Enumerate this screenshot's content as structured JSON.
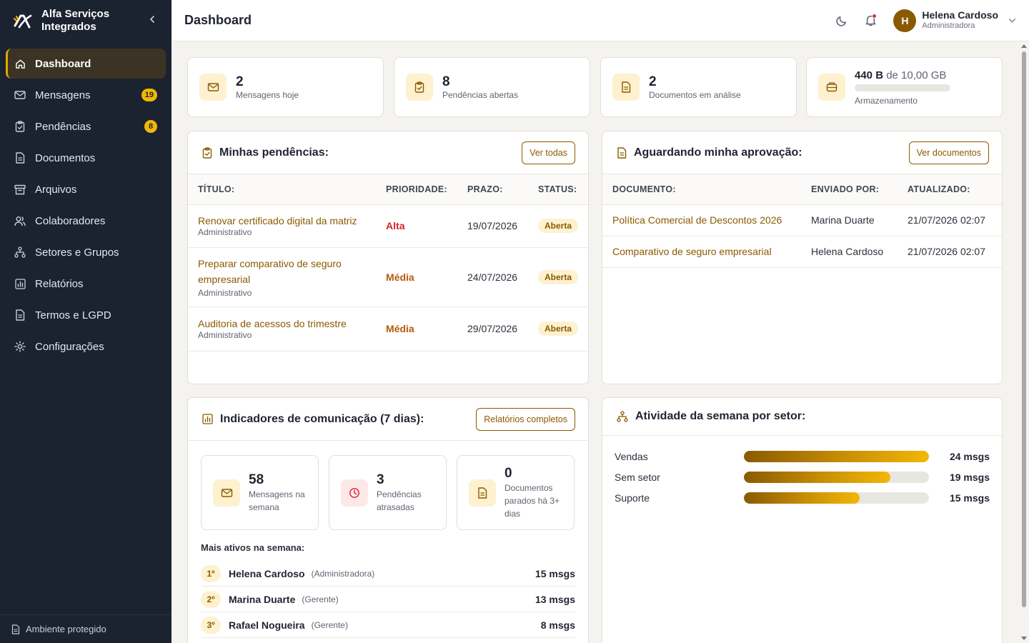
{
  "brand": {
    "name": "Alfa Serviços Integrados"
  },
  "sidebar": {
    "items": [
      {
        "label": "Dashboard",
        "icon": "home-icon",
        "active": true,
        "badge": ""
      },
      {
        "label": "Mensagens",
        "icon": "mail-icon",
        "active": false,
        "badge": "19"
      },
      {
        "label": "Pendências",
        "icon": "clipboard-icon",
        "active": false,
        "badge": "8"
      },
      {
        "label": "Documentos",
        "icon": "document-icon",
        "active": false,
        "badge": ""
      },
      {
        "label": "Arquivos",
        "icon": "archive-icon",
        "active": false,
        "badge": ""
      },
      {
        "label": "Colaboradores",
        "icon": "users-icon",
        "active": false,
        "badge": ""
      },
      {
        "label": "Setores e Grupos",
        "icon": "hierarchy-icon",
        "active": false,
        "badge": ""
      },
      {
        "label": "Relatórios",
        "icon": "chart-icon",
        "active": false,
        "badge": ""
      },
      {
        "label": "Termos e LGPD",
        "icon": "document-icon",
        "active": false,
        "badge": ""
      },
      {
        "label": "Configurações",
        "icon": "gear-icon",
        "active": false,
        "badge": ""
      }
    ],
    "footer": "Ambiente protegido"
  },
  "header": {
    "title": "Dashboard",
    "user": {
      "initial": "H",
      "name": "Helena Cardoso",
      "role": "Administradora"
    }
  },
  "stats": {
    "messages": {
      "value": "2",
      "label": "Mensagens hoje"
    },
    "pending": {
      "value": "8",
      "label": "Pendências abertas"
    },
    "documents": {
      "value": "2",
      "label": "Documentos em análise"
    },
    "storage": {
      "used": "440 B",
      "of": "de 10,00 GB",
      "label": "Armazenamento",
      "fraction": 0.0
    }
  },
  "pendencias": {
    "title": "Minhas pendências:",
    "button": "Ver todas",
    "columns": [
      "TÍTULO:",
      "PRIORIDADE:",
      "PRAZO:",
      "STATUS:"
    ],
    "rows": [
      {
        "title": "Renovar certificado digital da matriz",
        "sector": "Administrativo",
        "priority": "Alta",
        "deadline": "19/07/2026",
        "status": "Aberta"
      },
      {
        "title": "Preparar comparativo de seguro empresarial",
        "sector": "Administrativo",
        "priority": "Média",
        "deadline": "24/07/2026",
        "status": "Aberta"
      },
      {
        "title": "Auditoria de acessos do trimestre",
        "sector": "Administrativo",
        "priority": "Média",
        "deadline": "29/07/2026",
        "status": "Aberta"
      }
    ]
  },
  "aprovacao": {
    "title": "Aguardando minha aprovação:",
    "button": "Ver documentos",
    "columns": [
      "DOCUMENTO:",
      "ENVIADO POR:",
      "ATUALIZADO:"
    ],
    "rows": [
      {
        "document": "Política Comercial de Descontos 2026",
        "sender": "Marina Duarte",
        "updated": "21/07/2026 02:07"
      },
      {
        "document": "Comparativo de seguro empresarial",
        "sender": "Helena Cardoso",
        "updated": "21/07/2026 02:07"
      }
    ]
  },
  "indicadores": {
    "title": "Indicadores de comunicação (7 dias):",
    "button": "Relatórios completos",
    "cards": [
      {
        "value": "58",
        "label": "Mensagens na semana"
      },
      {
        "value": "3",
        "label": "Pendências atrasadas"
      },
      {
        "value": "0",
        "label": "Documentos parados há 3+ dias"
      }
    ],
    "ranking_title": "Mais ativos na semana:",
    "ranking": [
      {
        "pos": "1º",
        "name": "Helena Cardoso",
        "role": "(Administradora)",
        "count": "15 msgs"
      },
      {
        "pos": "2º",
        "name": "Marina Duarte",
        "role": "(Gerente)",
        "count": "13 msgs"
      },
      {
        "pos": "3º",
        "name": "Rafael Nogueira",
        "role": "(Gerente)",
        "count": "8 msgs"
      }
    ]
  },
  "atividade": {
    "title": "Atividade da semana por setor:",
    "max": 24,
    "sectors": [
      {
        "name": "Vendas",
        "value": 24,
        "label": "24 msgs"
      },
      {
        "name": "Sem setor",
        "value": 19,
        "label": "19 msgs"
      },
      {
        "name": "Suporte",
        "value": 15,
        "label": "15 msgs"
      }
    ]
  }
}
